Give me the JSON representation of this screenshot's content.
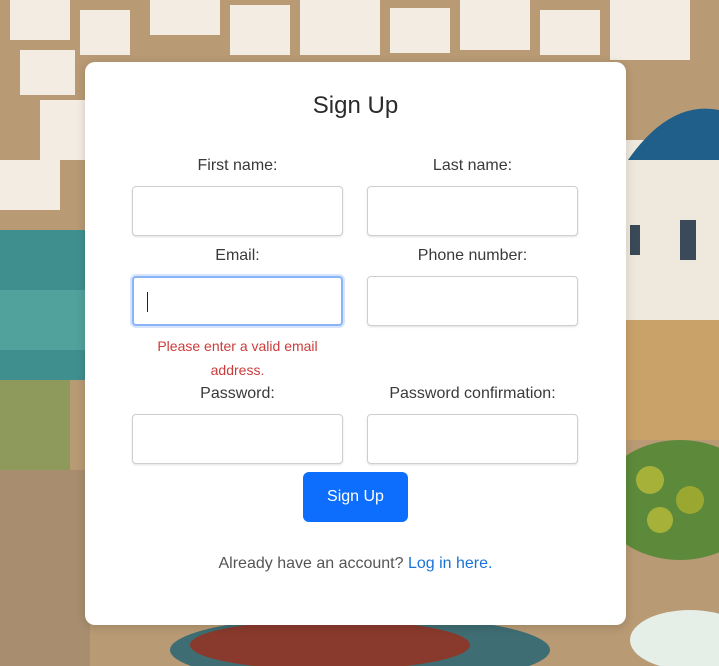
{
  "form": {
    "title": "Sign Up",
    "fields": {
      "first_name": {
        "label": "First name:",
        "value": ""
      },
      "last_name": {
        "label": "Last name:",
        "value": ""
      },
      "email": {
        "label": "Email:",
        "value": "",
        "error": "Please enter a valid email address."
      },
      "phone": {
        "label": "Phone number:",
        "value": ""
      },
      "password": {
        "label": "Password:",
        "value": ""
      },
      "password_confirmation": {
        "label": "Password confirmation:",
        "value": ""
      }
    },
    "submit_label": "Sign Up",
    "login_prompt": "Already have an account?",
    "login_link": "Log in here."
  },
  "colors": {
    "accent": "#0d6efd",
    "error": "#cc3b3b",
    "link": "#1a73d6",
    "focus_ring": "#8ab4f8"
  }
}
